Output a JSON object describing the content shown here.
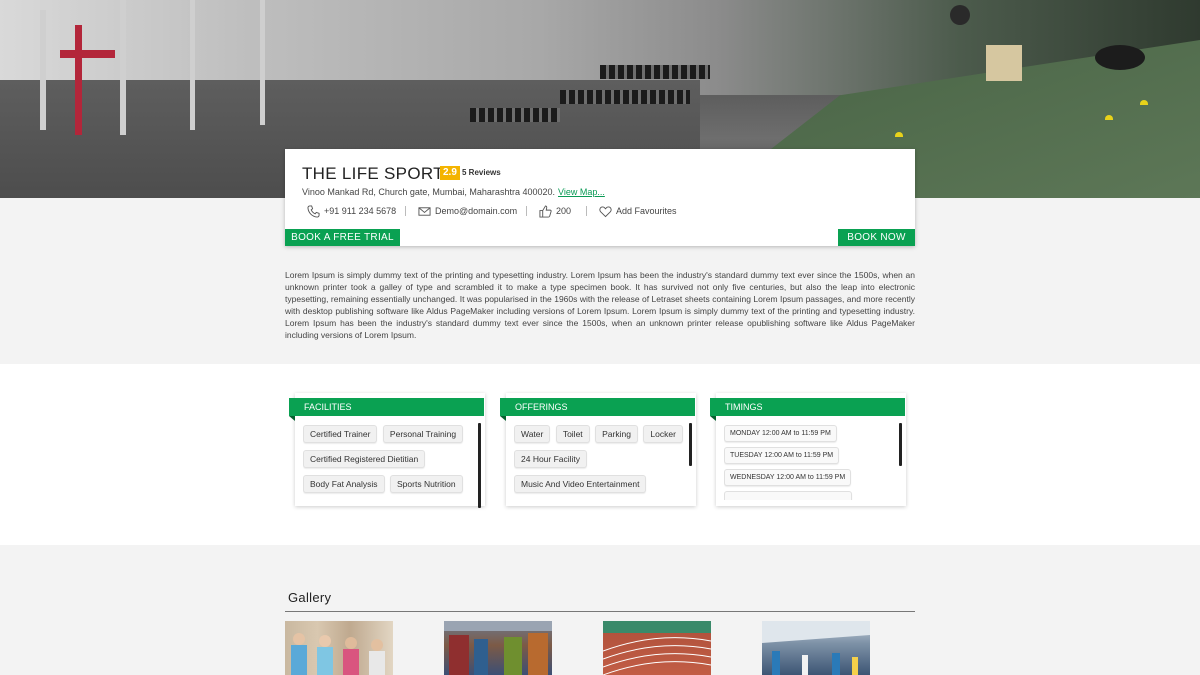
{
  "listing": {
    "name": "THE LIFE SPORTS",
    "rating": "2.9",
    "reviews": "5 Reviews",
    "address": "Vinoo Mankad Rd, Church gate, Mumbai, Maharashtra 400020.",
    "map_link": "View Map...",
    "phone": "+91 911 234 5678",
    "email": "Demo@domain.com",
    "likes": "200",
    "favourites": "Add Favourites",
    "trial_label": "BOOK A FREE TRIAL",
    "book_label": "BOOK NOW"
  },
  "description": "Lorem Ipsum is simply dummy text of the printing and typesetting industry. Lorem Ipsum has been the industry's standard dummy text ever since the 1500s, when an unknown printer took a galley of type and scrambled it to make a type specimen book. It has survived not only five centuries, but also the leap into electronic typesetting, remaining essentially unchanged. It was popularised in the 1960s with the release of Letraset sheets containing Lorem Ipsum passages, and more recently with desktop publishing software like Aldus PageMaker including versions of Lorem Ipsum. Lorem Ipsum is simply dummy text of the printing and typesetting industry. Lorem Ipsum has been the industry's standard dummy text ever since the 1500s, when an unknown printer release opublishing software like Aldus PageMaker including versions of Lorem Ipsum.",
  "facilities": {
    "title": "FACILITIES",
    "items": [
      "Certified Trainer",
      "Personal Training",
      "Certified Registered Dietitian",
      "Body Fat Analysis",
      "Sports Nutrition"
    ]
  },
  "offerings": {
    "title": "OFFERINGS",
    "items": [
      "Water",
      "Toilet",
      "Parking",
      "Locker",
      "24 Hour Facility",
      "Music And Video Entertainment"
    ]
  },
  "timings": {
    "title": "TIMINGS",
    "items": [
      "MONDAY 12:00 AM to 11:59 PM",
      "TUESDAY 12:00 AM to 11:59 PM",
      "WEDNESDAY 12:00 AM to 11:59 PM",
      ""
    ]
  },
  "gallery": {
    "title": "Gallery"
  },
  "colors": {
    "accent": "#0aa152",
    "rating_badge": "#f4b400"
  }
}
